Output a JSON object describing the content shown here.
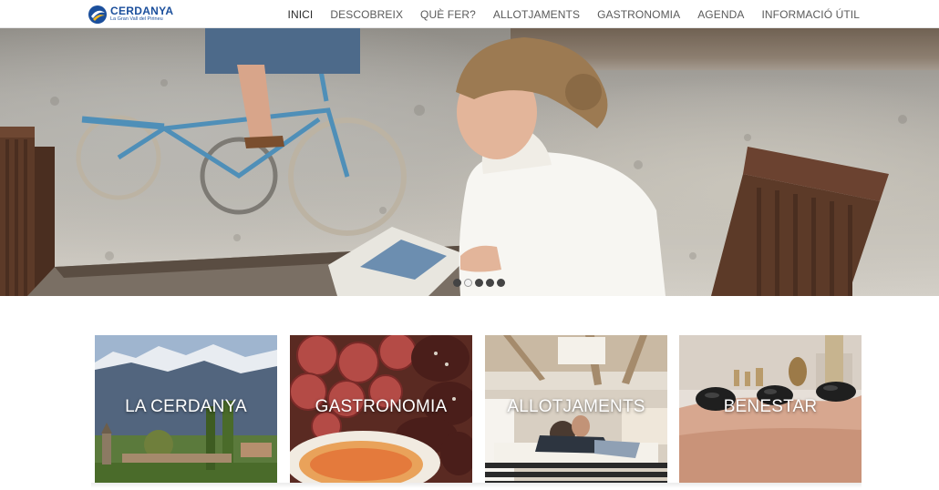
{
  "header": {
    "logo": {
      "name": "CERDANYA",
      "tagline": "La Gran Vall del Pirineu"
    },
    "nav": [
      {
        "label": "INICI",
        "active": true
      },
      {
        "label": "DESCOBREIX",
        "active": false
      },
      {
        "label": "QUÈ FER?",
        "active": false
      },
      {
        "label": "ALLOTJAMENTS",
        "active": false
      },
      {
        "label": "GASTRONOMIA",
        "active": false
      },
      {
        "label": "AGENDA",
        "active": false
      },
      {
        "label": "INFORMACIÓ ÚTIL",
        "active": false
      }
    ]
  },
  "hero": {
    "slide_count": 5,
    "active_slide": 2
  },
  "tiles": [
    {
      "label": "LA CERDANYA"
    },
    {
      "label": "GASTRONOMIA"
    },
    {
      "label": "ALLOTJAMENTS"
    },
    {
      "label": "BENESTAR"
    }
  ],
  "colors": {
    "brand_blue": "#1b4f9c",
    "brand_yellow": "#f3b71e",
    "nav_text": "#5a5a5a"
  }
}
